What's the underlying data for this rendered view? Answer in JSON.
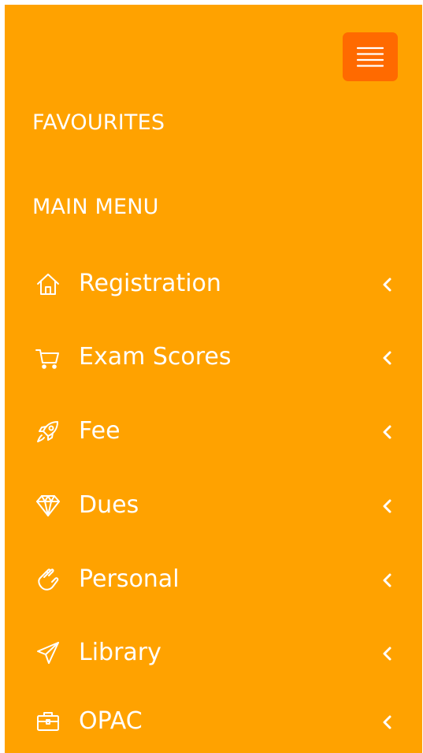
{
  "header": {
    "menu_icon": "hamburger-menu-icon",
    "menu_button_color": "#FF6A00"
  },
  "theme": {
    "panel_color": "#FFA200",
    "text_color": "#FFFFFF"
  },
  "sections": {
    "favourites": "FAVOURITES",
    "main_menu": "MAIN MENU"
  },
  "menu": {
    "items": [
      {
        "label": "Registration",
        "icon": "home-icon"
      },
      {
        "label": "Exam Scores",
        "icon": "cart-icon"
      },
      {
        "label": "Fee",
        "icon": "rocket-icon"
      },
      {
        "label": "Dues",
        "icon": "diamond-icon"
      },
      {
        "label": "Personal",
        "icon": "hand-icon"
      },
      {
        "label": "Library",
        "icon": "paper-plane-icon"
      },
      {
        "label": "OPAC",
        "icon": "briefcase-icon"
      }
    ],
    "expand_icon": "chevron-left-icon"
  }
}
